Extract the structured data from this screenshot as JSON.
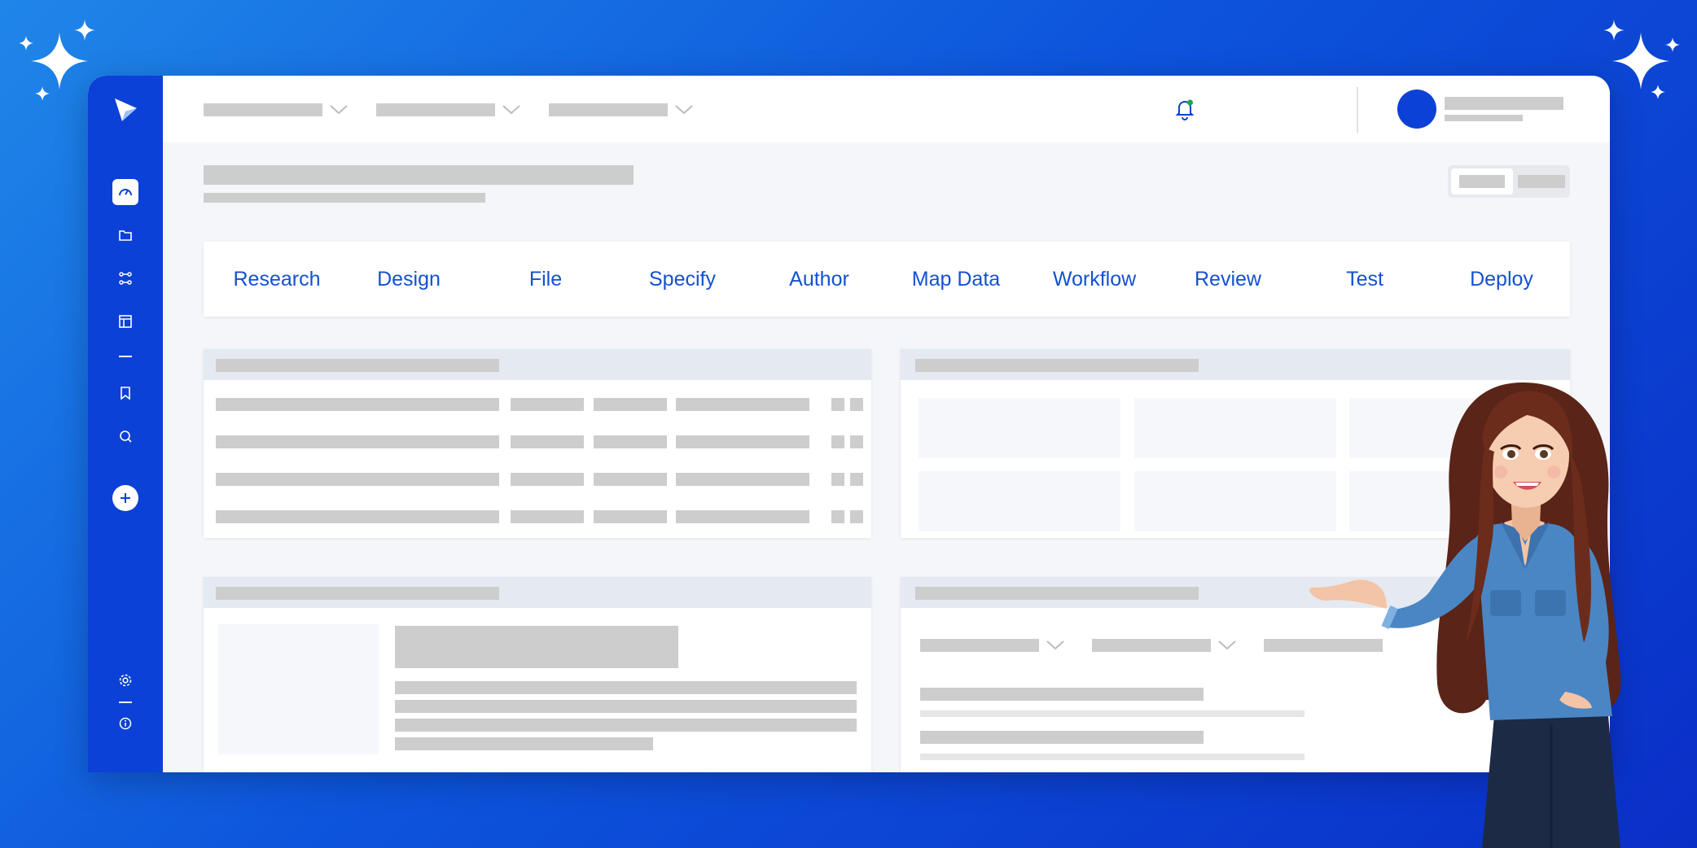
{
  "window": {
    "accent_color": "#0b41d6",
    "tab_text_color": "#1451cf"
  },
  "sidebar": {
    "logo": "play-logo",
    "items": [
      {
        "icon": "dashboard-gauge-icon",
        "active": true
      },
      {
        "icon": "folder-icon"
      },
      {
        "icon": "nodes-icon"
      },
      {
        "icon": "layout-icon"
      },
      {
        "icon": "bookmark-icon"
      },
      {
        "icon": "search-icon"
      }
    ],
    "add_icon": "plus-icon",
    "bottom": [
      {
        "icon": "gear-icon"
      },
      {
        "icon": "info-icon"
      }
    ]
  },
  "topbar": {
    "notification_icon": "bell-icon",
    "apps_icon": "grid-apps-icon"
  },
  "tabs": [
    "Research",
    "Design",
    "File",
    "Specify",
    "Author",
    "Map Data",
    "Workflow",
    "Review",
    "Test",
    "Deploy"
  ]
}
